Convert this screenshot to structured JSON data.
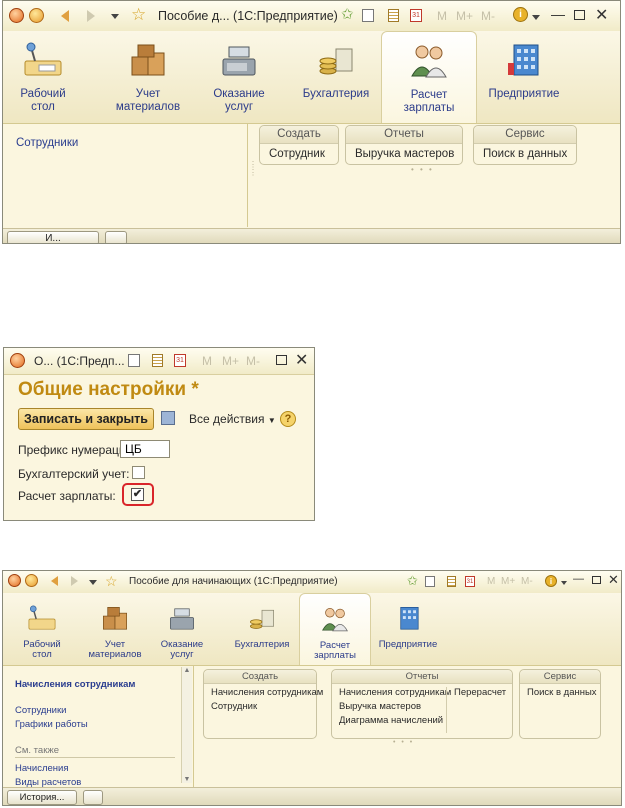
{
  "window1": {
    "title": "Пособие д... (1С:Предприятие)",
    "title_bar_m": "M",
    "title_bar_mplus": "M+",
    "title_bar_mminus": "M-",
    "sections": [
      {
        "label_line1": "Рабочий",
        "label_line2": "стол",
        "icon": "desk-icon"
      },
      {
        "label_line1": "Учет",
        "label_line2": "материалов",
        "icon": "boxes-icon"
      },
      {
        "label_line1": "Оказание",
        "label_line2": "услуг",
        "icon": "cash-register-icon"
      },
      {
        "label_line1": "Бухгалтерия",
        "label_line2": "",
        "icon": "coins-icon"
      },
      {
        "label_line1": "Расчет",
        "label_line2": "зарплаты",
        "icon": "people-icon"
      },
      {
        "label_line1": "Предприятие",
        "label_line2": "",
        "icon": "building-icon"
      }
    ],
    "nav_items": [
      "Сотрудники"
    ],
    "groups": [
      {
        "title": "Создать",
        "items": [
          "Сотрудник"
        ]
      },
      {
        "title": "Отчеты",
        "items": [
          "Выручка мастеров"
        ]
      },
      {
        "title": "Сервис",
        "items": [
          "Поиск в данных"
        ]
      }
    ],
    "bottom_history_label": "И..."
  },
  "window2": {
    "title": "О... (1С:Предп...",
    "title_bar_m": "M",
    "title_bar_mplus": "M+",
    "title_bar_mminus": "M-",
    "form_title": "Общие настройки *",
    "save_close_button": "Записать и закрыть",
    "all_actions_label": "Все действия",
    "help_glyph": "?",
    "fields": {
      "prefix_label": "Префикс нумерации:",
      "prefix_value": "ЦБ",
      "accounting_label": "Бухгалтерский учет:",
      "accounting_checked": false,
      "payroll_label": "Расчет зарплаты:",
      "payroll_checked": true
    },
    "highlight_color": "#d9252a"
  },
  "window3": {
    "title": "Пособие для начинающих (1С:Предприятие)",
    "title_bar_m": "M",
    "title_bar_mplus": "M+",
    "title_bar_mminus": "M-",
    "sections": [
      {
        "label_line1": "Рабочий",
        "label_line2": "стол"
      },
      {
        "label_line1": "Учет",
        "label_line2": "материалов"
      },
      {
        "label_line1": "Оказание",
        "label_line2": "услуг"
      },
      {
        "label_line1": "Бухгалтерия",
        "label_line2": ""
      },
      {
        "label_line1": "Расчет",
        "label_line2": "зарплаты"
      },
      {
        "label_line1": "Предприятие",
        "label_line2": ""
      }
    ],
    "nav_heading": "Начисления сотрудникам",
    "nav_items": [
      "Сотрудники",
      "Графики работы"
    ],
    "nav_see_also": "См. также",
    "nav_see_also_items": [
      "Начисления",
      "Виды расчетов"
    ],
    "groups": {
      "create": {
        "title": "Создать",
        "items": [
          "Начисления сотрудникам",
          "Сотрудник"
        ]
      },
      "reports": {
        "title": "Отчеты",
        "col1": [
          "Начисления сотрудникам",
          "Выручка мастеров",
          "Диаграмма начислений"
        ],
        "col2": [
          "Перерасчет"
        ]
      },
      "service": {
        "title": "Сервис",
        "items": [
          "Поиск в данных"
        ]
      }
    },
    "history_button": "История..."
  },
  "colors": {
    "panel_bg": "#fbf6df",
    "section_link": "#2b3b8a",
    "nav_link": "#2a3d8f",
    "form_title": "#c08a12"
  }
}
